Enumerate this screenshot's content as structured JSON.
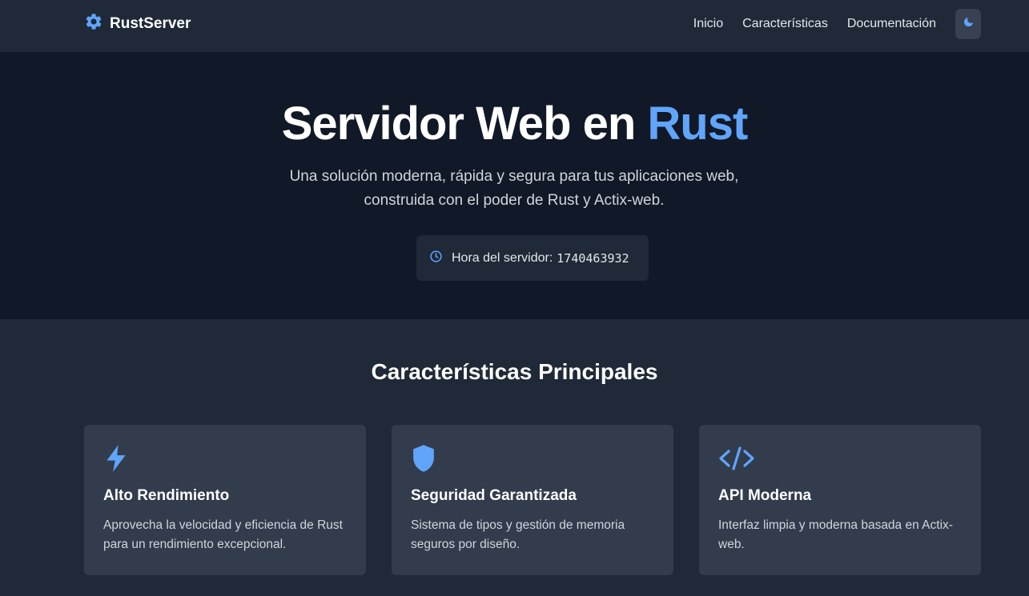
{
  "brand": {
    "name": "RustServer",
    "icon": "gear-icon",
    "color": "#60a5fa"
  },
  "nav": {
    "links": [
      {
        "label": "Inicio"
      },
      {
        "label": "Características"
      },
      {
        "label": "Documentación"
      }
    ],
    "theme_toggle_icon": "moon-icon"
  },
  "hero": {
    "title_main": "Servidor Web en ",
    "title_accent": "Rust",
    "subtitle_line1": "Una solución moderna, rápida y segura para tus aplicaciones web,",
    "subtitle_line2": "construida con el poder de Rust y Actix-web.",
    "server_time_label": "Hora del servidor:",
    "server_time_value": "1740463932",
    "clock_icon": "clock-icon"
  },
  "features": {
    "title": "Características Principales",
    "cards": [
      {
        "icon": "lightning-icon",
        "title": "Alto Rendimiento",
        "text": "Aprovecha la velocidad y eficiencia de Rust para un rendimiento excepcional."
      },
      {
        "icon": "shield-icon",
        "title": "Seguridad Garantizada",
        "text": "Sistema de tipos y gestión de memoria seguros por diseño."
      },
      {
        "icon": "code-icon",
        "title": "API Moderna",
        "text": "Interfaz limpia y moderna basada en Actix-web."
      }
    ]
  },
  "colors": {
    "accent": "#60a5fa",
    "nav_bg": "#1f2937",
    "hero_bg": "#111827",
    "card_bg": "#323c4d"
  }
}
